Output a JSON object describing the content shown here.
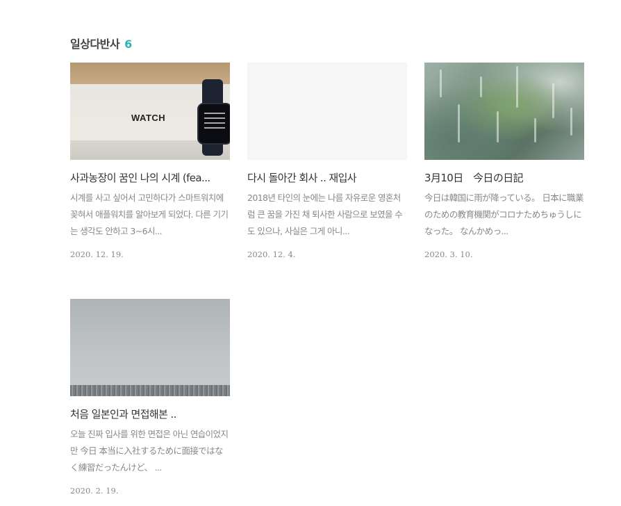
{
  "category": {
    "title": "일상다반사",
    "count": "6"
  },
  "posts": [
    {
      "title": "사과농장이 꿈인 나의 시계 (fea...",
      "summary": "시계를 사고 싶어서 고민하다가 스마트워치에 꽂혀서 애플워치를 알아보게 되었다. 다른 기기는 생각도 안하고 3~6시...",
      "date": "2020. 12. 19.",
      "thumb_text": "WATCH",
      "thumb_icon": "apple-icon"
    },
    {
      "title": "다시 돌아간 회사 .. 재입사",
      "summary": "2018년 타인의 눈에는 나름 자유로운 영혼처럼 큰 꿈을 가진 채 퇴사한 사람으로 보였을 수도 있으나, 사실은 그게 아니...",
      "date": "2020. 12. 4."
    },
    {
      "title": "3月10日　今日の日記",
      "summary": "今日は韓国に雨が降っている。 日本に職業のための教育機関がコロナためちゅうしになった。 なんかめっ...",
      "date": "2020. 3. 10."
    },
    {
      "title": "처음 일본인과 면접해본 ..",
      "summary": "오늘 진짜 입사를 위한 면접은 아닌 연습이었지만 今日 本当に入社するために面接ではなく練習だったんけど、 ...",
      "date": "2020. 2. 19."
    }
  ]
}
